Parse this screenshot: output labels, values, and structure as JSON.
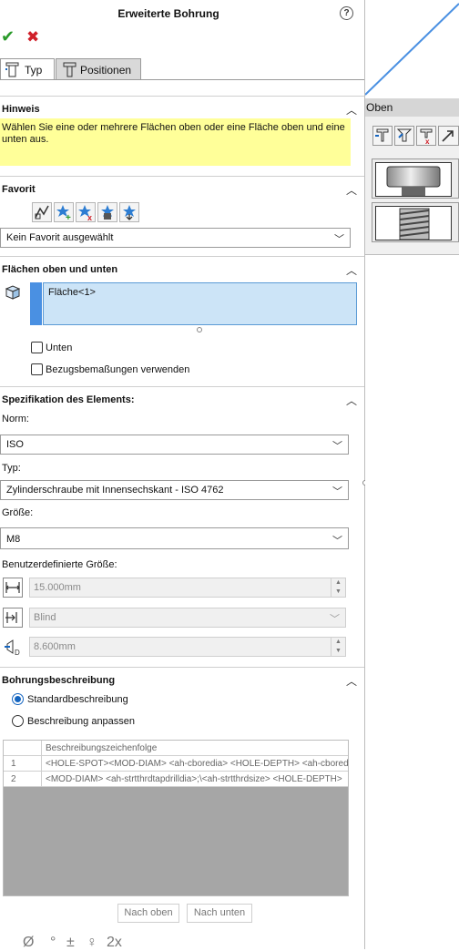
{
  "panel": {
    "title": "Erweiterte Bohrung",
    "help_glyph": "?",
    "ok_glyph": "✔",
    "cancel_glyph": "✖"
  },
  "tabs": [
    {
      "label": "Typ",
      "active": true
    },
    {
      "label": "Positionen",
      "active": false
    }
  ],
  "hinweis": {
    "header": "Hinweis",
    "text": "Wählen Sie eine oder mehrere Flächen oben oder eine Fläche oben und eine unten aus."
  },
  "favorit": {
    "header": "Favorit",
    "selected": "Kein Favorit ausgewählt",
    "buttons": [
      "apply-defaults-icon",
      "add-favorite-icon",
      "delete-favorite-icon",
      "save-favorite-icon",
      "load-favorite-icon"
    ]
  },
  "flaechen": {
    "header": "Flächen oben und unten",
    "selection": "Fläche<1>",
    "unten_label": "Unten",
    "unten_checked": false,
    "bezug_label": "Bezugsbemaßungen verwenden",
    "bezug_checked": false
  },
  "spezifikation": {
    "header": "Spezifikation des Elements:",
    "norm_label": "Norm:",
    "norm_value": "ISO",
    "typ_label": "Typ:",
    "typ_value": "Zylinderschraube mit Innensechskant - ISO 4762",
    "groesse_label": "Größe:",
    "groesse_value": "M8",
    "custom_label": "Benutzerdefinierte Größe:",
    "diameter_value": "15.000mm",
    "end_condition": "Blind",
    "depth_value": "8.600mm"
  },
  "beschreibung": {
    "header": "Bohrungsbeschreibung",
    "option_standard": "Standardbeschreibung",
    "option_custom": "Beschreibung anpassen",
    "selected": "standard",
    "column_header": "Beschreibungszeichenfolge",
    "rows": [
      {
        "num": "1",
        "text": "<HOLE-SPOT><MOD-DIAM> <ah-cboredia> <HOLE-DEPTH> <ah-cboredepth>"
      },
      {
        "num": "2",
        "text": "<MOD-DIAM> <ah-strtthrdtapdrilldia>;\\<ah-strtthrdsize> <HOLE-DEPTH>"
      }
    ],
    "btn_up": "Nach oben",
    "btn_down": "Nach unten",
    "symbols": [
      "Ø",
      "°",
      "±",
      "♀",
      "2x"
    ]
  },
  "viewport": {
    "view_label": "Oben",
    "line_color": "#4a90e2"
  },
  "colors": {
    "accent": "#1565c0",
    "hint_bg": "#ffff99",
    "selection_bg": "#cce4f7"
  }
}
